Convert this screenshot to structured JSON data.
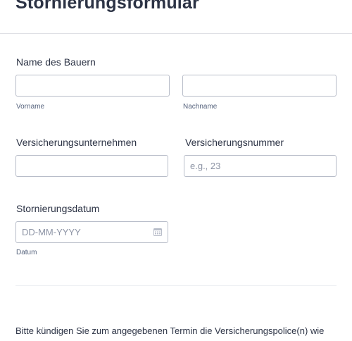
{
  "form": {
    "title": "Stornierungsformular"
  },
  "farmer_name": {
    "label": "Name des Bauern",
    "first": {
      "value": "",
      "sublabel": "Vorname"
    },
    "last": {
      "value": "",
      "sublabel": "Nachname"
    }
  },
  "insurance_company": {
    "label": "Versicherungsunternehmen",
    "value": ""
  },
  "insurance_number": {
    "label": "Versicherungsnummer",
    "placeholder": "e.g., 23",
    "value": ""
  },
  "cancellation_date": {
    "label": "Stornierungsdatum",
    "placeholder": "DD-MM-YYYY",
    "sublabel": "Datum",
    "icon": "calendar-icon"
  },
  "instructions": {
    "text": "Bitte kündigen Sie zum angegebenen Termin die Versicherungspolice(n) wie oben beschrieben."
  }
}
